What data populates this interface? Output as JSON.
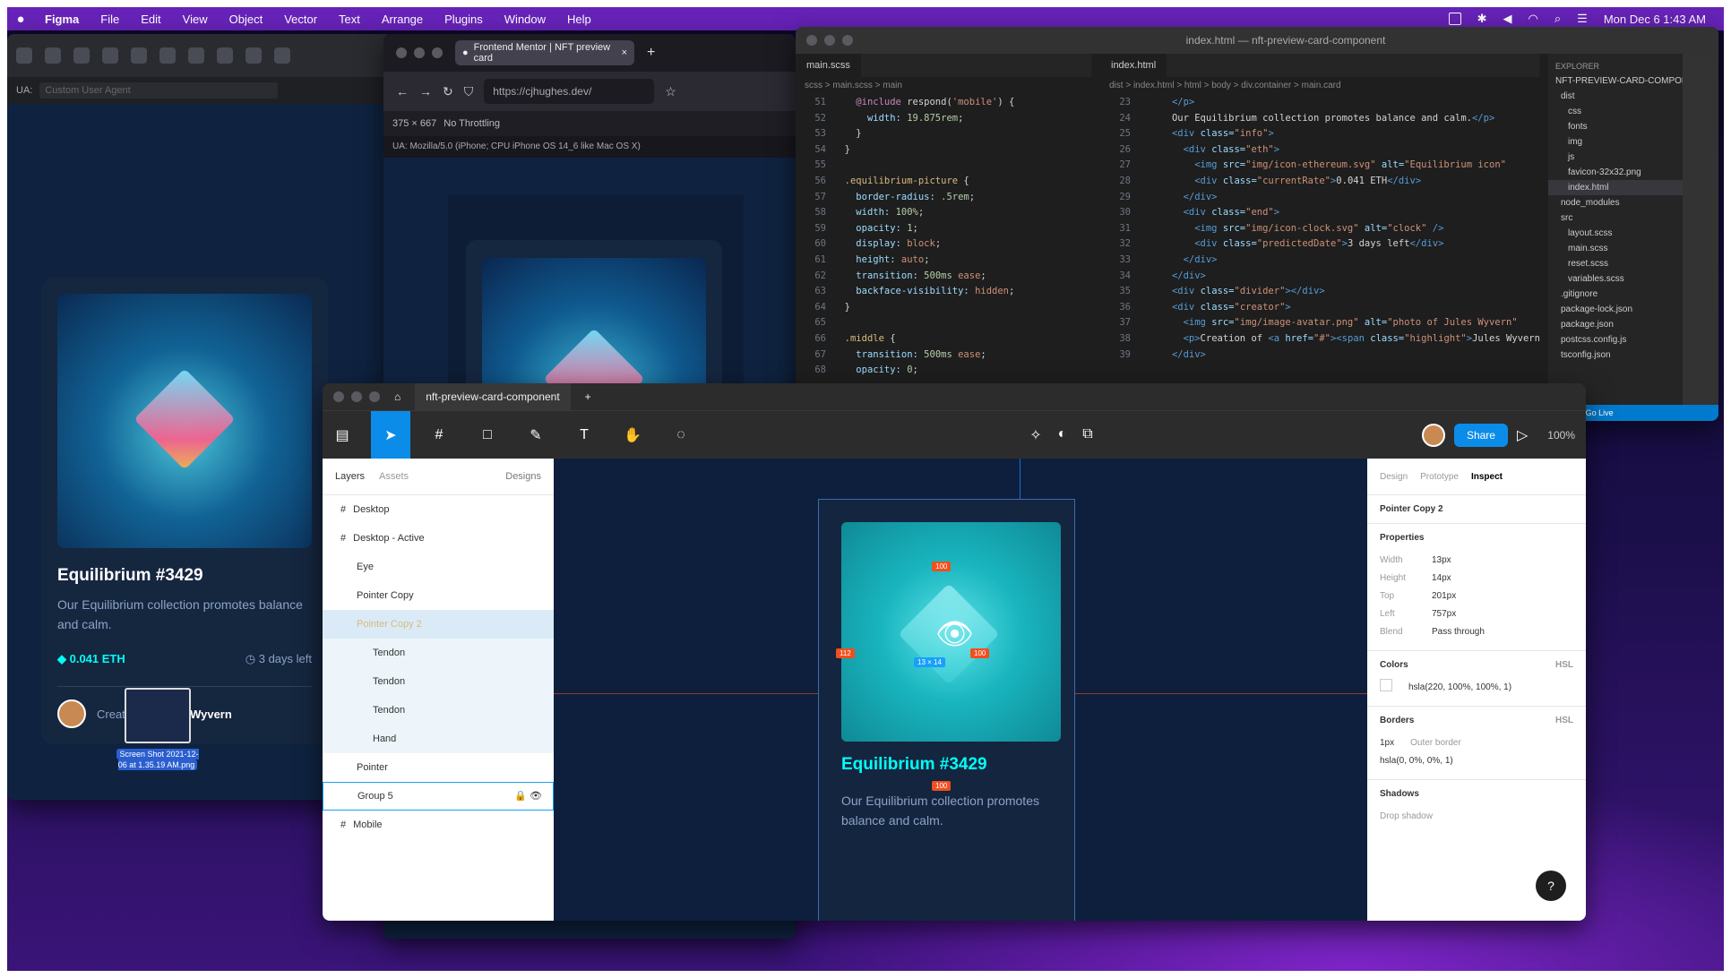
{
  "menubar": {
    "app": "Figma",
    "items": [
      "File",
      "Edit",
      "View",
      "Object",
      "Vector",
      "Text",
      "Arrange",
      "Plugins",
      "Window",
      "Help"
    ],
    "clock": "Mon Dec 6  1:43 AM"
  },
  "preview_app": {
    "ua_label": "UA:",
    "ua_placeholder": "Custom User Agent",
    "card": {
      "title": "Equilibrium #3429",
      "description": "Our Equilibrium collection promotes balance and calm.",
      "price": "0.041 ETH",
      "time_left": "3 days left",
      "creator_prefix": "Creation of",
      "creator_name": "Jules Wyvern"
    }
  },
  "browser": {
    "tab_title": "Frontend Mentor | NFT preview card",
    "url": "https://cjhughes.dev/",
    "device_dims": "375 × 667",
    "throttle": "No Throttling",
    "ua_string": "UA: Mozilla/5.0 (iPhone; CPU iPhone OS 14_6 like Mac OS X)"
  },
  "vscode": {
    "window_title": "index.html — nft-preview-card-component",
    "left_tab": "main.scss",
    "left_crumbs": "scss > main.scss > main",
    "right_tab": "index.html",
    "right_crumbs": "dist > index.html > html > body > div.container > main.card",
    "explorer_title": "EXPLORER",
    "explorer_items": [
      "NFT-PREVIEW-CARD-COMPONENT",
      "dist",
      "css",
      "fonts",
      "img",
      "js",
      "favicon-32x32.png",
      "index.html",
      "node_modules",
      "src",
      "layout.scss",
      "main.scss",
      "reset.scss",
      "variables.scss",
      ".gitignore",
      "package-lock.json",
      "package.json",
      "postcss.config.js",
      "tsconfig.json"
    ],
    "status": "⊗ 0 ⚠ 0 Go Live"
  },
  "figma": {
    "file_tab": "nft-preview-card-component",
    "share_label": "Share",
    "zoom": "100%",
    "layer_tabs": [
      "Layers",
      "Assets"
    ],
    "page_select": "Designs",
    "layers": [
      "Desktop",
      "Desktop - Active",
      "Eye",
      "Pointer Copy",
      "Pointer Copy 2",
      "Tendon",
      "Tendon",
      "Tendon",
      "Hand",
      "Pointer",
      "Group 5",
      "Mobile"
    ],
    "inspect_tabs": [
      "Design",
      "Prototype",
      "Inspect"
    ],
    "selected_layer": "Pointer Copy 2",
    "properties_title": "Properties",
    "properties": [
      {
        "k": "Width",
        "v": "13px"
      },
      {
        "k": "Height",
        "v": "14px"
      },
      {
        "k": "Top",
        "v": "201px"
      },
      {
        "k": "Left",
        "v": "757px"
      },
      {
        "k": "Blend",
        "v": "Pass through"
      }
    ],
    "colors_title": "Colors",
    "colors_mode": "HSL",
    "color_value": "hsla(220, 100%, 100%, 1)",
    "borders_title": "Borders",
    "border_width": "1px",
    "border_style": "Outer border",
    "border_color": "hsla(0, 0%, 0%, 1)",
    "shadows_title": "Shadows",
    "shadow_value": "Drop shadow",
    "canvas_card_title": "Equilibrium #3429",
    "canvas_card_desc": "Our Equilibrium collection promotes balance and calm.",
    "measure_top": "100",
    "measure_left": "112",
    "measure_right": "100",
    "measure_size": "13 × 14",
    "measure_bottom": "100"
  },
  "desktop_icon": {
    "label": "Screen Shot 2021-12-06 at 1.35.19 AM.png"
  },
  "colors": {
    "accent": "#0c8ce9",
    "cyan": "#00fff8",
    "card_bg": "#15263f",
    "page_bg": "#0d1f3c"
  }
}
